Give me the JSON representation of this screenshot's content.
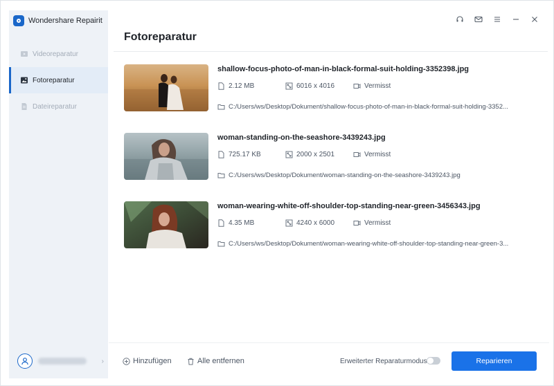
{
  "app": {
    "title": "Wondershare Repairit"
  },
  "sidebar": {
    "items": [
      {
        "label": "Videoreparatur",
        "icon": "video-icon",
        "active": false
      },
      {
        "label": "Fotoreparatur",
        "icon": "photo-icon",
        "active": true
      },
      {
        "label": "Dateireparatur",
        "icon": "file-icon",
        "active": false
      }
    ],
    "user_chevron": "›"
  },
  "window_controls": [
    "headset-icon",
    "mail-icon",
    "menu-icon",
    "minimize-icon",
    "close-icon"
  ],
  "main": {
    "title": "Fotoreparatur",
    "files": [
      {
        "name": "shallow-focus-photo-of-man-in-black-formal-suit-holding-3352398.jpg",
        "size": "2.12  MB",
        "resolution": "6016 x 4016",
        "camera": "Vermisst",
        "path": "C:/Users/ws/Desktop/Dokument/shallow-focus-photo-of-man-in-black-formal-suit-holding-3352..."
      },
      {
        "name": "woman-standing-on-the-seashore-3439243.jpg",
        "size": "725.17  KB",
        "resolution": "2000 x 2501",
        "camera": "Vermisst",
        "path": "C:/Users/ws/Desktop/Dokument/woman-standing-on-the-seashore-3439243.jpg"
      },
      {
        "name": "woman-wearing-white-off-shoulder-top-standing-near-green-3456343.jpg",
        "size": "4.35  MB",
        "resolution": "4240 x 6000",
        "camera": "Vermisst",
        "path": "C:/Users/ws/Desktop/Dokument/woman-wearing-white-off-shoulder-top-standing-near-green-3..."
      }
    ]
  },
  "bottom": {
    "add_label": "Hinzufügen",
    "clear_label": "Alle entfernen",
    "advanced_label": "Erweiterter Reparaturmodus",
    "advanced_enabled": false,
    "repair_label": "Reparieren"
  },
  "colors": {
    "accent": "#1a72e8",
    "sidebar_bg": "#eef2f7",
    "active_item_bg": "#e3ecf7"
  }
}
